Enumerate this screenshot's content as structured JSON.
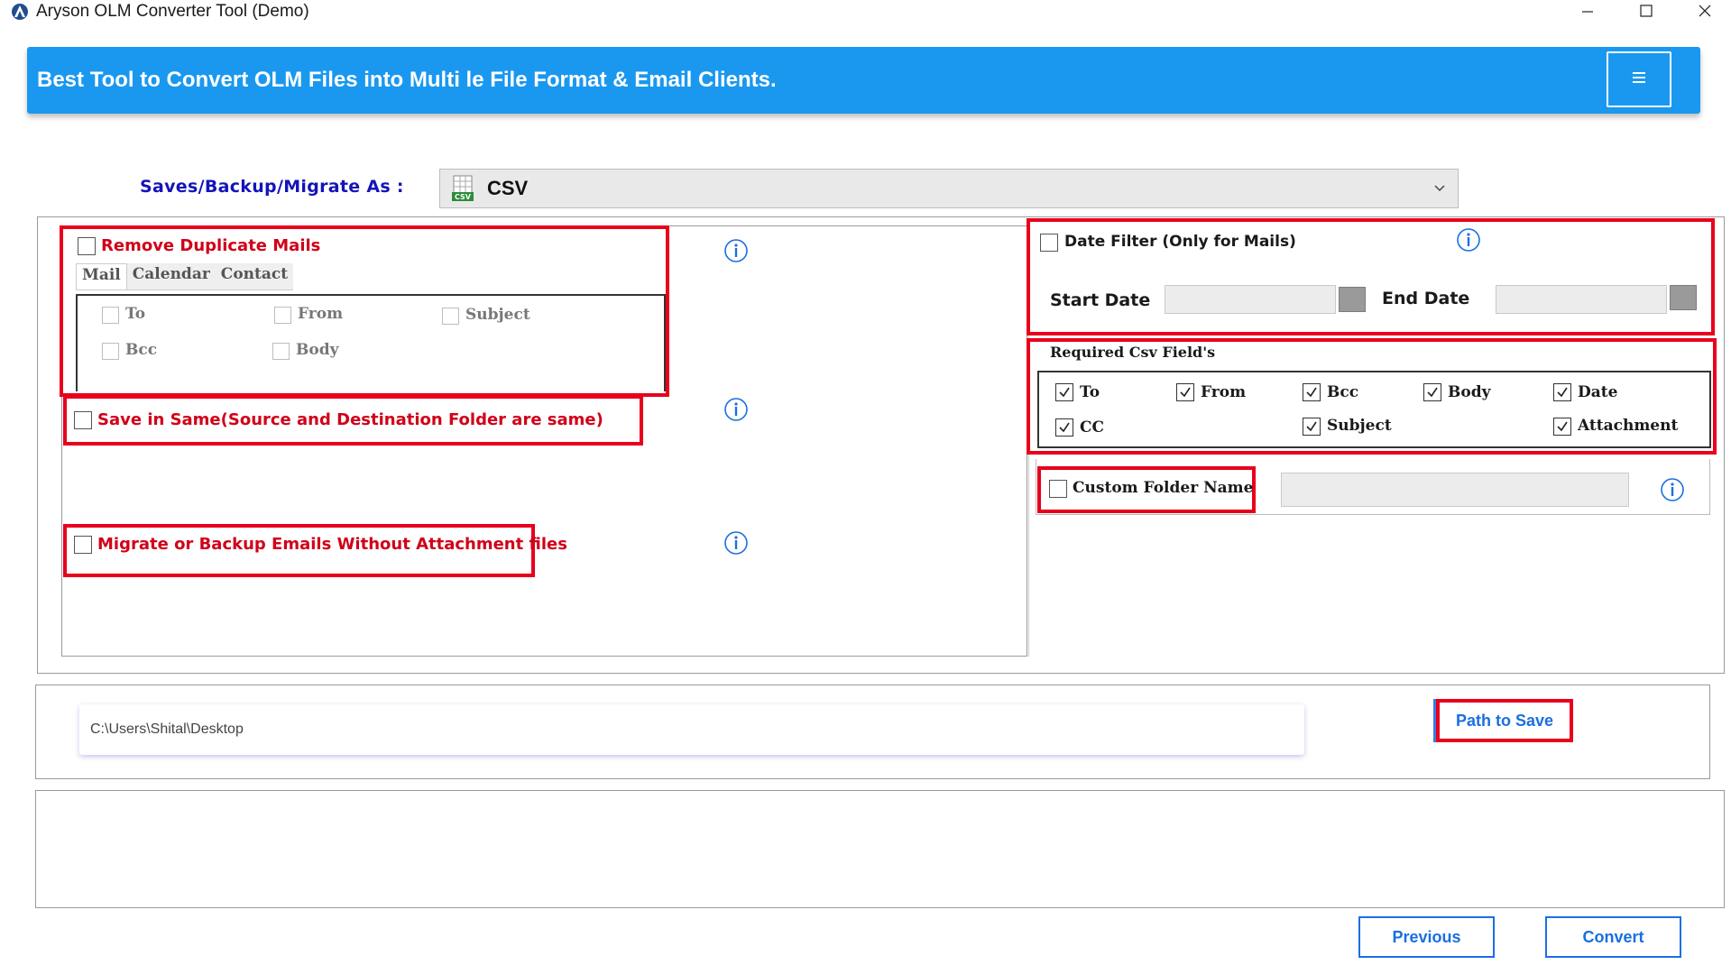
{
  "window": {
    "title": "Aryson OLM Converter Tool (Demo)",
    "icons": [
      "app-logo-icon",
      "minimize-icon",
      "maximize-icon",
      "close-icon"
    ]
  },
  "banner": {
    "text": "Best Tool to Convert OLM Files into Multi le File Format & Email Clients.",
    "menu_icon": "hamburger-menu-icon"
  },
  "format": {
    "label": "Saves/Backup/Migrate As :",
    "selected": "CSV",
    "icon": "csv-file-icon"
  },
  "left": {
    "remove_duplicates": {
      "label": "Remove Duplicate Mails",
      "checked": false,
      "tabs": [
        "Mail",
        "Calendar",
        "Contact"
      ],
      "active_tab": "Mail",
      "fields": [
        "To",
        "From",
        "Subject",
        "Bcc",
        "Body"
      ]
    },
    "save_in_same": {
      "label": "Save in Same(Source and Destination Folder are same)",
      "checked": false
    },
    "without_attachment": {
      "label": "Migrate or Backup Emails Without Attachment files",
      "checked": false
    }
  },
  "right": {
    "date_filter": {
      "label": "Date Filter  (Only for Mails)",
      "checked": false,
      "start_label": "Start Date",
      "end_label": "End Date",
      "start_value": "",
      "end_value": ""
    },
    "csv_fields": {
      "title": "Required Csv Field's",
      "fields": [
        "To",
        "From",
        "Bcc",
        "Body",
        "Date",
        "CC",
        "Subject",
        "Attachment"
      ],
      "checked": [
        true,
        true,
        true,
        true,
        true,
        true,
        true,
        true
      ]
    },
    "custom_folder": {
      "label": "Custom Folder Name",
      "checked": false,
      "value": ""
    }
  },
  "path": {
    "value": "C:\\Users\\Shital\\Desktop",
    "button": "Path to Save"
  },
  "nav": {
    "previous": "Previous",
    "convert": "Convert"
  },
  "colors": {
    "banner": "#1a98f0",
    "highlight_red": "#e8001c",
    "label_blue": "#1414b8",
    "button_blue": "#1a6fe0"
  }
}
